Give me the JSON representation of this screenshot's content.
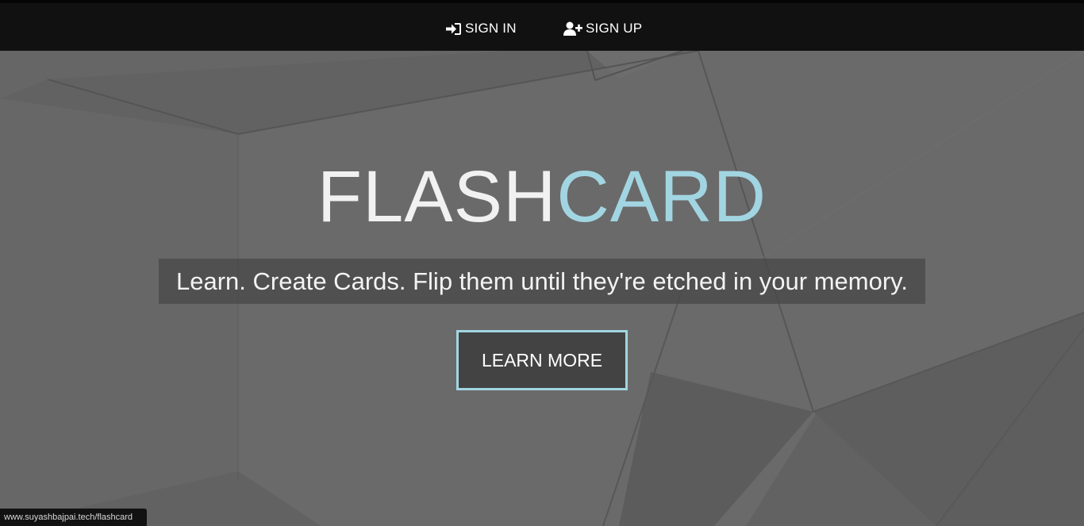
{
  "nav": {
    "sign_in_label": "SIGN IN",
    "sign_up_label": "SIGN UP",
    "sign_in_icon": "sign-in-icon",
    "sign_up_icon": "user-plus-icon"
  },
  "hero": {
    "title_part1": "FLASH",
    "title_part2": "CARD",
    "tagline": "Learn. Create Cards. Flip them until they're etched in your memory.",
    "cta_label": "LEARN MORE"
  },
  "status_bar": {
    "url": "www.suyashbajpai.tech/flashcard"
  },
  "colors": {
    "navbar_bg": "#111111",
    "hero_bg": "#636363",
    "accent": "#a2d5e2",
    "button_bg": "#434343",
    "text": "#ffffff"
  }
}
